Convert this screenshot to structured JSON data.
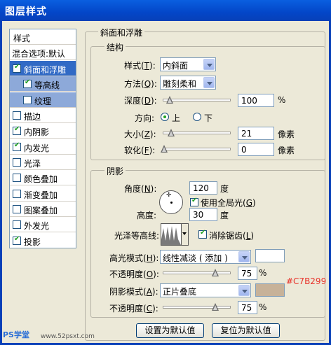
{
  "window": {
    "title": "图层样式"
  },
  "sidebar": {
    "header": "样式",
    "blend": "混合选项:默认",
    "items": [
      {
        "label": "斜面和浮雕",
        "checked": true
      },
      {
        "label": "等高线",
        "checked": true
      },
      {
        "label": "纹理",
        "checked": false
      },
      {
        "label": "描边",
        "checked": false
      },
      {
        "label": "内阴影",
        "checked": true
      },
      {
        "label": "内发光",
        "checked": true
      },
      {
        "label": "光泽",
        "checked": false
      },
      {
        "label": "颜色叠加",
        "checked": false
      },
      {
        "label": "渐变叠加",
        "checked": false
      },
      {
        "label": "图案叠加",
        "checked": false
      },
      {
        "label": "外发光",
        "checked": false
      },
      {
        "label": "投影",
        "checked": true
      }
    ]
  },
  "bevel": {
    "title": "斜面和浮雕",
    "structure": {
      "title": "结构",
      "style_label": "样式(",
      "style_key": "T",
      "style_end": "):",
      "style_value": "内斜面",
      "technique_label": "方法(",
      "technique_key": "Q",
      "technique_end": "):",
      "technique_value": "雕刻柔和",
      "depth_label": "深度(",
      "depth_key": "D",
      "depth_end": "):",
      "depth_value": "100",
      "depth_unit": "%",
      "direction_label": "方向:",
      "dir_up": "上",
      "dir_down": "下",
      "size_label": "大小(",
      "size_key": "Z",
      "size_end": "):",
      "size_value": "21",
      "size_unit": "像素",
      "soften_label": "软化(",
      "soften_key": "F",
      "soften_end": "):",
      "soften_value": "0",
      "soften_unit": "像素"
    },
    "shading": {
      "title": "阴影",
      "angle_label": "角度(",
      "angle_key": "N",
      "angle_end": "):",
      "angle_value": "120",
      "angle_unit": "度",
      "global_light_label": "使用全局光(",
      "global_light_key": "G",
      "global_light_end": ")",
      "altitude_label": "高度:",
      "altitude_value": "30",
      "altitude_unit": "度",
      "gloss_label": "光泽等高线:",
      "antialias_label": "消除锯齿(",
      "antialias_key": "L",
      "antialias_end": ")",
      "highlight_label": "高光模式(",
      "highlight_key": "H",
      "highlight_end": "):",
      "highlight_value": "线性减淡 ( 添加 )",
      "highlight_opacity_label": "不透明度(",
      "highlight_opacity_key": "O",
      "highlight_opacity_end": "):",
      "highlight_opacity_value": "75",
      "highlight_opacity_unit": "%",
      "shadow_label": "阴影模式(",
      "shadow_key": "A",
      "shadow_end": "):",
      "shadow_value": "正片叠底",
      "shadow_opacity_label": "不透明度(",
      "shadow_opacity_key": "C",
      "shadow_opacity_end": "):",
      "shadow_opacity_value": "75",
      "shadow_opacity_unit": "%",
      "shadow_color_annotation": "#C7B299"
    }
  },
  "buttons": {
    "make_default": "设置为默认值",
    "reset_default": "复位为默认值"
  },
  "watermark": {
    "left": "PS学堂",
    "right": "www.52psxt.com"
  },
  "colors": {
    "highlight": "#FFFFFF",
    "shadow": "#C7B299",
    "annotation": "#E8322A",
    "title_bar": "#0A5FE0"
  }
}
